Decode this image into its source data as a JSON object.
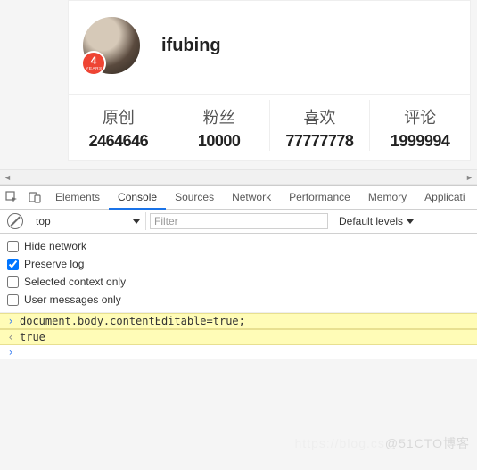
{
  "profile": {
    "username": "ifubing",
    "badge": {
      "number": "4",
      "unit": "YEARS"
    },
    "stats": [
      {
        "label": "原创",
        "value": "2464646"
      },
      {
        "label": "粉丝",
        "value": "10000"
      },
      {
        "label": "喜欢",
        "value": "77777778"
      },
      {
        "label": "评论",
        "value": "1999994"
      }
    ]
  },
  "devtools": {
    "tabs": [
      "Elements",
      "Console",
      "Sources",
      "Network",
      "Performance",
      "Memory",
      "Applicati"
    ],
    "active_tab_index": 1,
    "context": "top",
    "filter_placeholder": "Filter",
    "levels_label": "Default levels",
    "checks": [
      {
        "label": "Hide network",
        "checked": false
      },
      {
        "label": "Preserve log",
        "checked": true
      },
      {
        "label": "Selected context only",
        "checked": false
      },
      {
        "label": "User messages only",
        "checked": false
      }
    ],
    "console": {
      "input_line": "document.body.contentEditable=true;",
      "result_line": "true"
    }
  },
  "watermark": {
    "faint": "https://blog.cs",
    "main": "@51CTO博客"
  }
}
